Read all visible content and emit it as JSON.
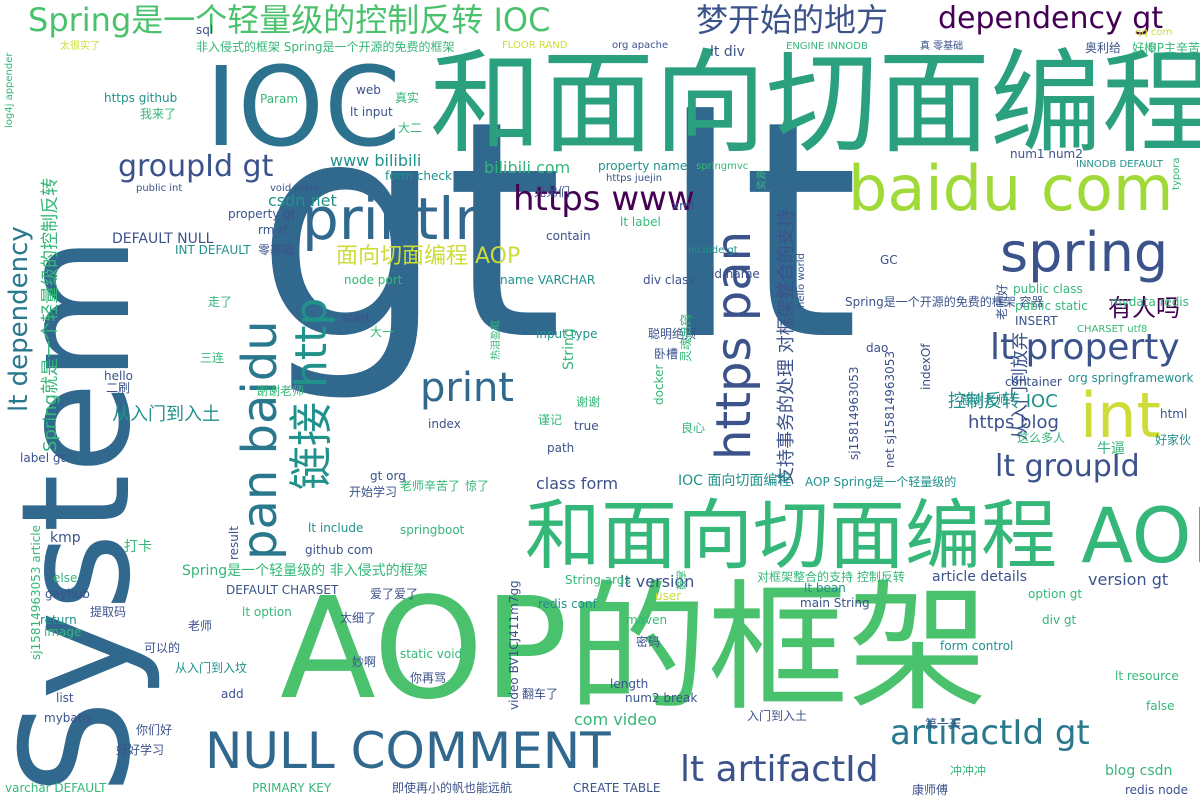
{
  "palette": {
    "navy": "#440154",
    "indigo": "#3b528b",
    "steel": "#31688e",
    "teal": "#21918c",
    "jade": "#35b779",
    "green": "#4ac16d",
    "lime": "#a0da39",
    "yellow": "#cddc39"
  },
  "words": [
    {
      "text": "gt lt",
      "color": "#31688e",
      "size": 300,
      "rot": false
    },
    {
      "text": "System",
      "color": "#31688e",
      "size": 150,
      "rot": true
    },
    {
      "text": "AOP的框架",
      "color": "#4ac16d",
      "size": 140,
      "rot": false
    },
    {
      "text": "IOC",
      "color": "#2c728e",
      "size": 110,
      "rot": false
    },
    {
      "text": "和面向切面编程",
      "color": "#2aa07e",
      "size": 112,
      "rot": false
    },
    {
      "text": "和面向切面编程 AOP",
      "color": "#35b779",
      "size": 76,
      "rot": false
    },
    {
      "text": "baidu com",
      "color": "#a0da39",
      "size": 62,
      "rot": false
    },
    {
      "text": "spring",
      "color": "#3b528b",
      "size": 54,
      "rot": false
    },
    {
      "text": "int",
      "color": "#cddc39",
      "size": 62,
      "rot": false
    },
    {
      "text": "println",
      "color": "#31688e",
      "size": 58,
      "rot": false
    },
    {
      "text": "NULL COMMENT",
      "color": "#31688e",
      "size": 50,
      "rot": false
    },
    {
      "text": "pan baidu",
      "color": "#2a788e",
      "size": 48,
      "rot": true
    },
    {
      "text": "https pan",
      "color": "#3b528b",
      "size": 48,
      "rot": true
    },
    {
      "text": "链接 http",
      "color": "#21918c",
      "size": 44,
      "rot": true
    },
    {
      "text": "print",
      "color": "#31688e",
      "size": 40,
      "rot": false
    },
    {
      "text": "lt artifactId",
      "color": "#3b528b",
      "size": 36,
      "rot": false
    },
    {
      "text": "artifactId gt",
      "color": "#2a788e",
      "size": 34,
      "rot": false
    },
    {
      "text": "Spring是一个轻量级的控制反转 IOC",
      "color": "#4ac16d",
      "size": 32,
      "rot": false
    },
    {
      "text": "梦开始的地方",
      "color": "#3b528b",
      "size": 32,
      "rot": false
    },
    {
      "text": "dependency gt",
      "color": "#440154",
      "size": 30,
      "rot": false
    },
    {
      "text": "lt property",
      "color": "#3b528b",
      "size": 36,
      "rot": false
    },
    {
      "text": "lt groupId",
      "color": "#3b528b",
      "size": 30,
      "rot": false
    },
    {
      "text": "groupId gt",
      "color": "#3b528b",
      "size": 30,
      "rot": false
    },
    {
      "text": "https www",
      "color": "#440154",
      "size": 34,
      "rot": false
    },
    {
      "text": "lt dependency",
      "color": "#2a788e",
      "size": 26,
      "rot": true
    },
    {
      "text": "面向切面编程 AOP",
      "color": "#cddc39",
      "size": 22,
      "rot": false
    },
    {
      "text": "有人吗",
      "color": "#440154",
      "size": 24,
      "rot": false
    },
    {
      "text": "Spring就是一个轻量级的控制反转",
      "color": "#35b779",
      "size": 18,
      "rot": true
    },
    {
      "text": "支持事务的处理 对框架整合的支持",
      "color": "#3b528b",
      "size": 18,
      "rot": true
    },
    {
      "text": "从入门到放弃",
      "color": "#3b528b",
      "size": 18,
      "rot": true
    },
    {
      "text": "sj15814963053 article",
      "color": "#35b779",
      "size": 12,
      "rot": true
    },
    {
      "text": "从入门到入土",
      "color": "#21918c",
      "size": 18,
      "rot": false
    },
    {
      "text": "控制反转 IOC",
      "color": "#21918c",
      "size": 18,
      "rot": false
    },
    {
      "text": "https blog",
      "color": "#3b528b",
      "size": 18,
      "rot": false
    },
    {
      "text": "www bilibili",
      "color": "#21918c",
      "size": 16,
      "rot": false
    },
    {
      "text": "bilibili com",
      "color": "#35b779",
      "size": 16,
      "rot": false
    },
    {
      "text": "csdn net",
      "color": "#21918c",
      "size": 16,
      "rot": false
    },
    {
      "text": "DEFAULT NULL",
      "color": "#3b528b",
      "size": 14,
      "rot": false
    },
    {
      "text": "property name",
      "color": "#21918c",
      "size": 12,
      "rot": false
    },
    {
      "text": "name VARCHAR",
      "color": "#21918c",
      "size": 12,
      "rot": false
    },
    {
      "text": "class form",
      "color": "#3b528b",
      "size": 16,
      "rot": false
    },
    {
      "text": "IOC 面向切面编程",
      "color": "#21918c",
      "size": 14,
      "rot": false
    },
    {
      "text": "AOP Spring是一个轻量级的",
      "color": "#21918c",
      "size": 12,
      "rot": false
    },
    {
      "text": "Spring是一个轻量级的 非入侵式的框架",
      "color": "#35b779",
      "size": 14,
      "rot": false
    },
    {
      "text": "lt version",
      "color": "#3b528b",
      "size": 16,
      "rot": false
    },
    {
      "text": "version gt",
      "color": "#3b528b",
      "size": 16,
      "rot": false
    },
    {
      "text": "article details",
      "color": "#3b528b",
      "size": 14,
      "rot": false
    },
    {
      "text": "com video",
      "color": "#35b779",
      "size": 16,
      "rot": false
    },
    {
      "text": "blog csdn",
      "color": "#35b779",
      "size": 14,
      "rot": false
    },
    {
      "text": "Spring是一个开源的免费的框架 容器",
      "color": "#3b528b",
      "size": 12,
      "rot": false
    },
    {
      "text": "public static",
      "color": "#35b779",
      "size": 12,
      "rot": false
    },
    {
      "text": "mydata redis",
      "color": "#35b779",
      "size": 12,
      "rot": false
    },
    {
      "text": "sj15814963053",
      "color": "#3b528b",
      "size": 12,
      "rot": true
    },
    {
      "text": "video BV1CJ411m7gg",
      "color": "#3b528b",
      "size": 12,
      "rot": true
    },
    {
      "text": "lt div",
      "color": "#3b528b",
      "size": 14,
      "rot": false
    },
    {
      "text": "https github",
      "color": "#21918c",
      "size": 12,
      "rot": false
    },
    {
      "text": "form check",
      "color": "#21918c",
      "size": 12,
      "rot": false
    },
    {
      "text": "property gt",
      "color": "#3b528b",
      "size": 12,
      "rot": false
    },
    {
      "text": "lt label",
      "color": "#35b779",
      "size": 12,
      "rot": false
    },
    {
      "text": "label gt",
      "color": "#3b528b",
      "size": 12,
      "rot": false
    },
    {
      "text": "lt include",
      "color": "#21918c",
      "size": 12,
      "rot": false
    },
    {
      "text": "include gt",
      "color": "#21918c",
      "size": 10,
      "rot": false
    },
    {
      "text": "lt option",
      "color": "#35b779",
      "size": 12,
      "rot": false
    },
    {
      "text": "option gt",
      "color": "#35b779",
      "size": 12,
      "rot": false
    },
    {
      "text": "lt bean",
      "color": "#21918c",
      "size": 12,
      "rot": false
    },
    {
      "text": "lt resource",
      "color": "#35b779",
      "size": 12,
      "rot": false
    },
    {
      "text": "form control",
      "color": "#21918c",
      "size": 12,
      "rot": false
    },
    {
      "text": "org springframework",
      "color": "#21918c",
      "size": 12,
      "rot": false
    },
    {
      "text": "container",
      "color": "#3b528b",
      "size": 12,
      "rot": false
    },
    {
      "text": "div gt",
      "color": "#35b779",
      "size": 12,
      "rot": false
    },
    {
      "text": "redis conf",
      "color": "#21918c",
      "size": 12,
      "rot": false
    },
    {
      "text": "static void",
      "color": "#35b779",
      "size": 12,
      "rot": false
    },
    {
      "text": "main String",
      "color": "#3b528b",
      "size": 12,
      "rot": false
    },
    {
      "text": "String args",
      "color": "#35b779",
      "size": 12,
      "rot": false
    },
    {
      "text": "github com",
      "color": "#3b528b",
      "size": 12,
      "rot": false
    },
    {
      "text": "lt input",
      "color": "#3b528b",
      "size": 12,
      "rot": false
    },
    {
      "text": "input type",
      "color": "#21918c",
      "size": 12,
      "rot": false
    },
    {
      "text": "DEFAULT CHARSET",
      "color": "#3b528b",
      "size": 12,
      "rot": false
    },
    {
      "text": "PRIMARY KEY",
      "color": "#35b779",
      "size": 12,
      "rot": false
    },
    {
      "text": "CREATE TABLE",
      "color": "#3b528b",
      "size": 12,
      "rot": false
    },
    {
      "text": "INT DEFAULT",
      "color": "#21918c",
      "size": 12,
      "rot": false
    },
    {
      "text": "ENGINE INNODB",
      "color": "#35b779",
      "size": 10,
      "rot": false
    },
    {
      "text": "INNODB DEFAULT",
      "color": "#21918c",
      "size": 10,
      "rot": false
    },
    {
      "text": "CHARSET utf8",
      "color": "#35b779",
      "size": 10,
      "rot": false
    },
    {
      "text": "varchar DEFAULT",
      "color": "#35b779",
      "size": 12,
      "rot": false
    },
    {
      "text": "redis node",
      "color": "#3b528b",
      "size": 12,
      "rot": false
    },
    {
      "text": "非入侵式的框架 Spring是一个开源的免费的框架",
      "color": "#35b779",
      "size": 12,
      "rot": false
    },
    {
      "text": "对框架整合的支持 控制反转",
      "color": "#35b779",
      "size": 12,
      "rot": false
    },
    {
      "text": "即使再小的帆也能远航",
      "color": "#3b528b",
      "size": 12,
      "rot": false
    },
    {
      "text": "好好学习",
      "color": "#3b528b",
      "size": 12,
      "rot": false
    },
    {
      "text": "你们好",
      "color": "#3b528b",
      "size": 12,
      "rot": false
    },
    {
      "text": "从入门到入坟",
      "color": "#21918c",
      "size": 12,
      "rot": false
    },
    {
      "text": "谢谢老师",
      "color": "#35b779",
      "size": 12,
      "rot": false
    },
    {
      "text": "感谢老师",
      "color": "#21918c",
      "size": 12,
      "rot": false
    },
    {
      "text": "老师辛苦了",
      "color": "#35b779",
      "size": 12,
      "rot": false
    },
    {
      "text": "开始学习",
      "color": "#3b528b",
      "size": 12,
      "rot": false
    },
    {
      "text": "聪明绝顶",
      "color": "#3b528b",
      "size": 12,
      "rot": false
    },
    {
      "text": "这么多人",
      "color": "#35b779",
      "size": 12,
      "rot": false
    },
    {
      "text": "牛逼",
      "color": "#35b779",
      "size": 14,
      "rot": false
    },
    {
      "text": "好家伙",
      "color": "#21918c",
      "size": 12,
      "rot": false
    },
    {
      "text": "冲冲冲",
      "color": "#35b779",
      "size": 12,
      "rot": false
    },
    {
      "text": "康师傅",
      "color": "#3b528b",
      "size": 12,
      "rot": false
    },
    {
      "text": "第一天",
      "color": "#3b528b",
      "size": 12,
      "rot": false
    },
    {
      "text": "入门到入土",
      "color": "#3b528b",
      "size": 12,
      "rot": false
    },
    {
      "text": "翻车了",
      "color": "#3b528b",
      "size": 12,
      "rot": false
    },
    {
      "text": "你再骂",
      "color": "#3b528b",
      "size": 12,
      "rot": false
    },
    {
      "text": "妙啊",
      "color": "#3b528b",
      "size": 12,
      "rot": false
    },
    {
      "text": "太细了",
      "color": "#3b528b",
      "size": 12,
      "rot": false
    },
    {
      "text": "爱了爱了",
      "color": "#3b528b",
      "size": 12,
      "rot": false
    },
    {
      "text": "可以的",
      "color": "#3b528b",
      "size": 12,
      "rot": false
    },
    {
      "text": "老师",
      "color": "#3b528b",
      "size": 12,
      "rot": false
    },
    {
      "text": "提取码",
      "color": "#3b528b",
      "size": 12,
      "rot": false
    },
    {
      "text": "打卡",
      "color": "#35b779",
      "size": 14,
      "rot": false
    },
    {
      "text": "二刷",
      "color": "#3b528b",
      "size": 12,
      "rot": false
    },
    {
      "text": "三连",
      "color": "#35b779",
      "size": 12,
      "rot": false
    },
    {
      "text": "走了",
      "color": "#35b779",
      "size": 12,
      "rot": false
    },
    {
      "text": "大一",
      "color": "#35b779",
      "size": 12,
      "rot": false
    },
    {
      "text": "真实",
      "color": "#35b779",
      "size": 12,
      "rot": false
    },
    {
      "text": "大二",
      "color": "#35b779",
      "size": 12,
      "rot": false
    },
    {
      "text": "我来了",
      "color": "#35b779",
      "size": 12,
      "rot": false
    },
    {
      "text": "兄弟们",
      "color": "#3b528b",
      "size": 12,
      "rot": false
    },
    {
      "text": "卧槽",
      "color": "#3b528b",
      "size": 12,
      "rot": false
    },
    {
      "text": "谢谢",
      "color": "#35b779",
      "size": 12,
      "rot": false
    },
    {
      "text": "良心",
      "color": "#35b779",
      "size": 12,
      "rot": false
    },
    {
      "text": "惊了",
      "color": "#35b779",
      "size": 12,
      "rot": false
    },
    {
      "text": "密码",
      "color": "#3b528b",
      "size": 12,
      "rot": false
    },
    {
      "text": "零基础",
      "color": "#3b528b",
      "size": 12,
      "rot": false
    },
    {
      "text": "奥利给",
      "color": "#3b528b",
      "size": 12,
      "rot": false
    },
    {
      "text": "好棒",
      "color": "#35b779",
      "size": 12,
      "rot": false
    },
    {
      "text": "UP主辛苦",
      "color": "#35b779",
      "size": 12,
      "rot": false
    },
    {
      "text": "kmp",
      "color": "#3b528b",
      "size": 14,
      "rot": false
    },
    {
      "text": "gayhub",
      "color": "#3b528b",
      "size": 12,
      "rot": false
    },
    {
      "text": "return",
      "color": "#21918c",
      "size": 12,
      "rot": false
    },
    {
      "text": "list",
      "color": "#3b528b",
      "size": 12,
      "rot": false
    },
    {
      "text": "add",
      "color": "#3b528b",
      "size": 12,
      "rot": false
    },
    {
      "text": "mybatis",
      "color": "#3b528b",
      "size": 12,
      "rot": false
    },
    {
      "text": "else",
      "color": "#35b779",
      "size": 12,
      "rot": false
    },
    {
      "text": "image",
      "color": "#35b779",
      "size": 12,
      "rot": false
    },
    {
      "text": "hello",
      "color": "#3b528b",
      "size": 12,
      "rot": false
    },
    {
      "text": "start",
      "color": "#3b528b",
      "size": 12,
      "rot": false
    },
    {
      "text": "String",
      "color": "#35b779",
      "size": 14,
      "rot": true
    },
    {
      "text": "index",
      "color": "#3b528b",
      "size": 12,
      "rot": false
    },
    {
      "text": "path",
      "color": "#3b528b",
      "size": 12,
      "rot": false
    },
    {
      "text": "true",
      "color": "#3b528b",
      "size": 12,
      "rot": false
    },
    {
      "text": "result",
      "color": "#3b528b",
      "size": 12,
      "rot": true
    },
    {
      "text": "user",
      "color": "#cddc39",
      "size": 12,
      "rot": false
    },
    {
      "text": "maven",
      "color": "#35b779",
      "size": 12,
      "rot": false
    },
    {
      "text": "length",
      "color": "#3b528b",
      "size": 12,
      "rot": false
    },
    {
      "text": "num2 break",
      "color": "#3b528b",
      "size": 12,
      "rot": false
    },
    {
      "text": "springboot",
      "color": "#35b779",
      "size": 12,
      "rot": false
    },
    {
      "text": "contain",
      "color": "#3b528b",
      "size": 12,
      "rot": false
    },
    {
      "text": "div class",
      "color": "#3b528b",
      "size": 12,
      "rot": false
    },
    {
      "text": "public int",
      "color": "#3b528b",
      "size": 10,
      "rot": false
    },
    {
      "text": "void main",
      "color": "#3b528b",
      "size": 10,
      "rot": false
    },
    {
      "text": "node port",
      "color": "#35b779",
      "size": 12,
      "rot": false
    },
    {
      "text": "id name",
      "color": "#3b528b",
      "size": 12,
      "rot": false
    },
    {
      "text": "INSERT",
      "color": "#3b528b",
      "size": 12,
      "rot": false
    },
    {
      "text": "GC",
      "color": "#3b528b",
      "size": 12,
      "rot": false
    },
    {
      "text": "dao",
      "color": "#3b528b",
      "size": 12,
      "rot": false
    },
    {
      "text": "html",
      "color": "#3b528b",
      "size": 12,
      "rot": false
    },
    {
      "text": "false",
      "color": "#35b779",
      "size": 12,
      "rot": false
    },
    {
      "text": "sql",
      "color": "#3b528b",
      "size": 12,
      "rot": false
    },
    {
      "text": "web",
      "color": "#3b528b",
      "size": 12,
      "rot": false
    },
    {
      "text": "xml",
      "color": "#3b528b",
      "size": 12,
      "rot": false
    },
    {
      "text": "Param",
      "color": "#35b779",
      "size": 12,
      "rot": false
    },
    {
      "text": "num1 num2",
      "color": "#3b528b",
      "size": 12,
      "rot": false
    },
    {
      "text": "public class",
      "color": "#35b779",
      "size": 12,
      "rot": false
    },
    {
      "text": "indexOf",
      "color": "#3b528b",
      "size": 12,
      "rot": true
    },
    {
      "text": "docker",
      "color": "#35b779",
      "size": 12,
      "rot": true
    },
    {
      "text": "gt org",
      "color": "#3b528b",
      "size": 12,
      "rot": false
    },
    {
      "text": "rm rf",
      "color": "#3b528b",
      "size": 12,
      "rot": false
    },
    {
      "text": "https juejin",
      "color": "#3b528b",
      "size": 10,
      "rot": false
    },
    {
      "text": "springmvc",
      "color": "#35b779",
      "size": 10,
      "rot": false
    },
    {
      "text": "org apache",
      "color": "#3b528b",
      "size": 10,
      "rot": false
    },
    {
      "text": "FLOOR RAND",
      "color": "#cddc39",
      "size": 10,
      "rot": false
    },
    {
      "text": "真 零基础",
      "color": "#3b528b",
      "size": 10,
      "rot": false
    },
    {
      "text": "qq com",
      "color": "#cddc39",
      "size": 10,
      "rot": false
    },
    {
      "text": "太很实了",
      "color": "#cddc39",
      "size": 10,
      "rot": false
    },
    {
      "text": "log4j appender",
      "color": "#35b779",
      "size": 10,
      "rot": true
    },
    {
      "text": "typora",
      "color": "#35b779",
      "size": 10,
      "rot": true
    },
    {
      "text": "老师好",
      "color": "#3b528b",
      "size": 12,
      "rot": true
    },
    {
      "text": "hello world",
      "color": "#3b528b",
      "size": 10,
      "rot": true
    },
    {
      "text": "net sj15814963053",
      "color": "#3b528b",
      "size": 12,
      "rot": true
    },
    {
      "text": "资源",
      "color": "#35b779",
      "size": 10,
      "rot": true
    },
    {
      "text": "鼓掌",
      "color": "#35b779",
      "size": 10,
      "rot": true
    },
    {
      "text": "谨记",
      "color": "#35b779",
      "size": 12,
      "rot": false
    },
    {
      "text": "灵魂出窍",
      "color": "#35b779",
      "size": 12,
      "rot": true
    },
    {
      "text": "热泪盈眶",
      "color": "#35b779",
      "size": 10,
      "rot": true
    }
  ]
}
